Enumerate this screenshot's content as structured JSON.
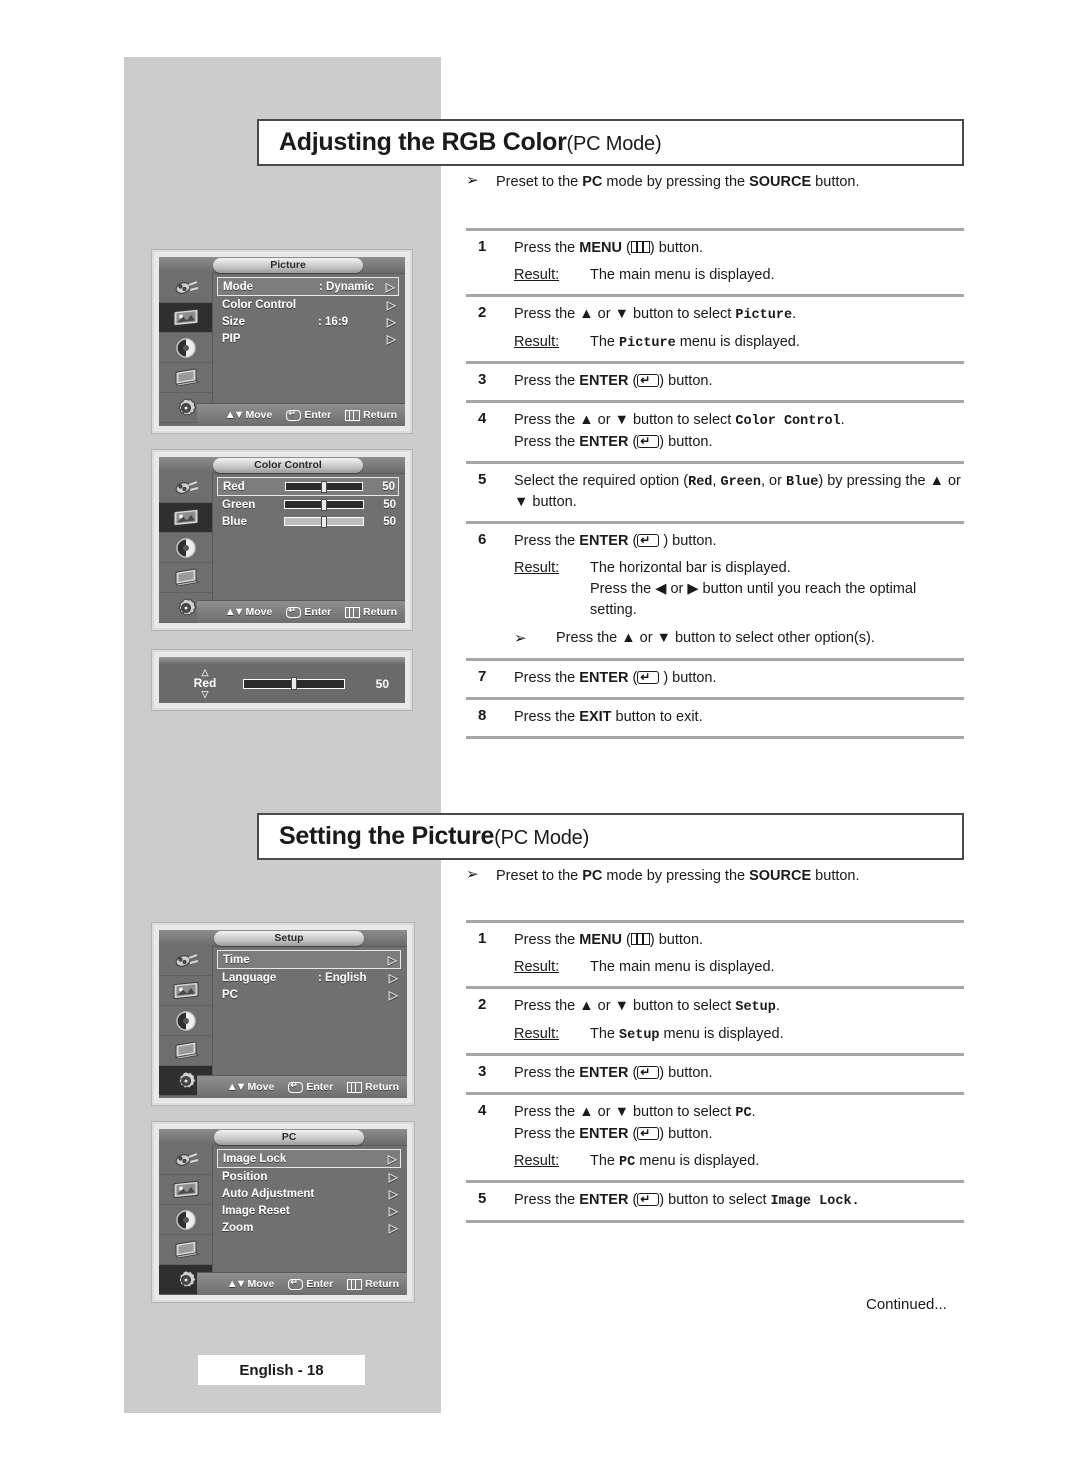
{
  "page": {
    "footer_note": "Continued...",
    "page_badge": "English - 18"
  },
  "sections": [
    {
      "heading_main": "Adjusting the RGB Color",
      "heading_sub": "(PC Mode)",
      "preset_note": {
        "arrow": "➢",
        "text_1": "Preset to the ",
        "bold_1": "PC",
        "text_2": " mode by pressing the ",
        "bold_2": "SOURCE",
        "text_3": " button."
      },
      "steps": [
        {
          "num": "1",
          "line1_a": "Press the ",
          "line1_b": "MENU",
          "line1_c": " (",
          "line1_icon": "menu-key-icon",
          "line1_d": ") button.",
          "result_label": "Result:",
          "result_text": "The main menu is displayed."
        },
        {
          "num": "2",
          "line1_a": "Press the ▲ or ▼ button to select ",
          "mono1": "Picture",
          "line1_d": ".",
          "result_label": "Result:",
          "result_a": "The ",
          "result_mono": "Picture",
          "result_b": " menu is displayed."
        },
        {
          "num": "3",
          "line1_a": "Press the ",
          "line1_b": "ENTER",
          "line1_c": " (",
          "line1_icon": "enter-key-icon",
          "line1_d": ") button."
        },
        {
          "num": "4",
          "line1_a": "Press the ▲ or ▼ button to select ",
          "mono1": "Color Control",
          "line1_d": ".",
          "line2_a": "Press the ",
          "line2_b": "ENTER",
          "line2_c": " (",
          "line2_icon": "enter-key-icon",
          "line2_d": ") button."
        },
        {
          "num": "5",
          "line1_a": "Select the required option (",
          "mono_red": "Red",
          "sep1": ", ",
          "mono_green": "Green",
          "sep2": ", or ",
          "mono_blue": "Blue",
          "line1_d": ") by pressing the ▲ or ▼ button."
        },
        {
          "num": "6",
          "line1_a": "Press the ",
          "line1_b": "ENTER",
          "line1_c": " (",
          "line1_icon": "enter-key-icon",
          "line1_d": " ) button.",
          "result_label": "Result:",
          "result_text": "The horizontal bar is displayed.",
          "result_text2": "Press the ◀ or ▶ button until you reach the optimal setting.",
          "subnote_arrow": "➢",
          "subnote_text": "Press the ▲ or ▼ button to select other option(s)."
        },
        {
          "num": "7",
          "line1_a": "Press the ",
          "line1_b": "ENTER",
          "line1_c": " (",
          "line1_icon": "enter-key-icon",
          "line1_d": " ) button."
        },
        {
          "num": "8",
          "line1_a": "Press the ",
          "line1_b": "EXIT",
          "line1_d": " button to exit."
        }
      ]
    },
    {
      "heading_main": "Setting the Picture",
      "heading_sub": "(PC Mode)",
      "preset_note": {
        "arrow": "➢",
        "text_1": "Preset to the ",
        "bold_1": "PC",
        "text_2": " mode by pressing the ",
        "bold_2": "SOURCE",
        "text_3": " button."
      },
      "steps": [
        {
          "num": "1",
          "line1_a": "Press the ",
          "line1_b": "MENU",
          "line1_c": " (",
          "line1_icon": "menu-key-icon",
          "line1_d": ") button.",
          "result_label": "Result:",
          "result_text": "The main menu is displayed."
        },
        {
          "num": "2",
          "line1_a": "Press the ▲ or ▼ button to select ",
          "mono1": "Setup",
          "line1_d": ".",
          "result_label": "Result:",
          "result_a": "The ",
          "result_mono": "Setup",
          "result_b": " menu is displayed."
        },
        {
          "num": "3",
          "line1_a": "Press the ",
          "line1_b": "ENTER",
          "line1_c": " (",
          "line1_icon": "enter-key-icon",
          "line1_d": ") button."
        },
        {
          "num": "4",
          "line1_a": "Press the ▲ or ▼ button to select ",
          "mono1": "PC",
          "line1_d": ".",
          "line2_a": "Press the ",
          "line2_b": "ENTER",
          "line2_c": " (",
          "line2_icon": "enter-key-icon",
          "line2_d": ") button.",
          "result_label": "Result:",
          "result_a": "The ",
          "result_mono": "PC",
          "result_b": "  menu is displayed."
        },
        {
          "num": "5",
          "line1_a": "Press the ",
          "line1_b": "ENTER",
          "line1_c": " (",
          "line1_icon": "enter-key-icon",
          "line1_d": ") button to select ",
          "mono_tail": "Image Lock."
        }
      ]
    }
  ],
  "osd_screens": [
    {
      "id": "picture-menu",
      "title": "Picture",
      "selected_sidebar_index": 1,
      "items": [
        {
          "label": "Mode",
          "value": ": Dynamic",
          "arrow": "▷",
          "selected": true
        },
        {
          "label": "Color Control",
          "value": "",
          "arrow": "▷",
          "selected": false
        },
        {
          "label": "Size",
          "value": ": 16:9",
          "arrow": "▷",
          "selected": false
        },
        {
          "label": "PIP",
          "value": "",
          "arrow": "▷",
          "selected": false
        }
      ],
      "footer": {
        "move": "Move",
        "enter": "Enter",
        "return": "Return"
      }
    },
    {
      "id": "color-control-menu",
      "title": "Color Control",
      "selected_sidebar_index": 1,
      "sliders": [
        {
          "label": "Red",
          "value": "50",
          "percent": 50,
          "selected": true,
          "dark": true
        },
        {
          "label": "Green",
          "value": "50",
          "percent": 50,
          "selected": false,
          "dark": true
        },
        {
          "label": "Blue",
          "value": "50",
          "percent": 50,
          "selected": false,
          "dark": false
        }
      ],
      "footer": {
        "move": "Move",
        "enter": "Enter",
        "return": "Return"
      }
    },
    {
      "id": "red-slider-bar",
      "label": "Red",
      "value": "50",
      "percent": 50,
      "caret_up": "△",
      "caret_down": "▽"
    },
    {
      "id": "setup-menu",
      "title": "Setup",
      "selected_sidebar_index": 4,
      "items": [
        {
          "label": "Time",
          "value": "",
          "arrow": "▷",
          "selected": true
        },
        {
          "label": "Language",
          "value": ": English",
          "arrow": "▷",
          "selected": false
        },
        {
          "label": "PC",
          "value": "",
          "arrow": "▷",
          "selected": false
        }
      ],
      "footer": {
        "move": "Move",
        "enter": "Enter",
        "return": "Return"
      }
    },
    {
      "id": "pc-menu",
      "title": "PC",
      "selected_sidebar_index": 4,
      "items": [
        {
          "label": "Image Lock",
          "value": "",
          "arrow": "▷",
          "selected": true
        },
        {
          "label": "Position",
          "value": "",
          "arrow": "▷",
          "selected": false
        },
        {
          "label": "Auto Adjustment",
          "value": "",
          "arrow": "▷",
          "selected": false
        },
        {
          "label": "Image Reset",
          "value": "",
          "arrow": "▷",
          "selected": false
        },
        {
          "label": "Zoom",
          "value": "",
          "arrow": "▷",
          "selected": false
        }
      ],
      "footer": {
        "move": "Move",
        "enter": "Enter",
        "return": "Return"
      }
    }
  ],
  "sidebar_icons": [
    "input-plug-icon",
    "picture-screen-icon",
    "sound-speaker-icon",
    "channel-book-icon",
    "setup-gear-icon"
  ]
}
